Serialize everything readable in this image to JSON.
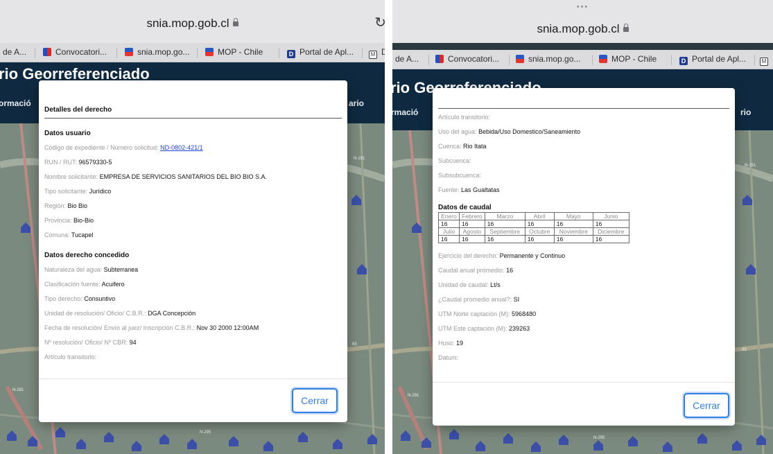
{
  "browser": {
    "url": "snia.mop.gob.cl",
    "more_dots": "•••",
    "bookmarks_left": [
      "de A...",
      "Convocatori...",
      "snia.mop.go...",
      "MOP - Chile",
      "Portal de Apl...",
      "D"
    ],
    "bookmarks_right": [
      "de A...",
      "Convocatori...",
      "snia.mop.go...",
      "MOP - Chile",
      "Portal de Apl..."
    ]
  },
  "site": {
    "title_left": "rio Georreferenciado",
    "title_right": "rio Georreferenciado",
    "nav_left": "ormació",
    "nav_right": "ario",
    "nav_left_r": "rmació",
    "nav_right_r": "rio"
  },
  "modal_left": {
    "title": "Detalles del derecho",
    "section_usuario": "Datos usuario",
    "expediente_label": "Código de expediente / Número solicitud:",
    "expediente_value": "ND-0802-421/1",
    "rut_label": "RUN / RUT:",
    "rut_value": "96579330-5",
    "nombre_label": "Nombre solicitante:",
    "nombre_value": "EMPRESA DE SERVICIOS SANITARIOS DEL BIO BIO S.A.",
    "tipo_sol_label": "Tipo solicitante:",
    "tipo_sol_value": "Jurídico",
    "region_label": "Región:",
    "region_value": "Bio Bio",
    "provincia_label": "Provincia:",
    "provincia_value": "Bio-Bio",
    "comuna_label": "Comuna:",
    "comuna_value": "Tucapel",
    "section_derecho": "Datos derecho concedido",
    "naturaleza_label": "Naturaleza del agua:",
    "naturaleza_value": "Subterranea",
    "clasif_label": "Clasificación fuente:",
    "clasif_value": "Acuifero",
    "tipo_der_label": "Tipo derecho:",
    "tipo_der_value": "Consuntivo",
    "unidad_res_label": "Unidad de resolución/ Oficio/ C.B.R.:",
    "unidad_res_value": "DGA Concepción",
    "fecha_label": "Fecha de resolución/ Envío al juez/ Inscripción C.B.R.:",
    "fecha_value": "Nov 30 2000 12:00AM",
    "nro_label": "Nº resolución/ Oficio/ Nº CBR:",
    "nro_value": "94",
    "articulo_label": "Artículo transitorio:",
    "close_label": "Cerrar"
  },
  "modal_right": {
    "articulo_label": "Artículo transitorio:",
    "uso_label": "Uso del agua:",
    "uso_value": "Bebida/Uso Domestico/Saneamiento",
    "cuenca_label": "Cuenca:",
    "cuenca_value": "Rio Itata",
    "subcuenca_label": "Subcuenca:",
    "subsubcuenca_label": "Subsubcuenca:",
    "fuente_label": "Fuente:",
    "fuente_value": "Las Gualtatas",
    "section_caudal": "Datos de caudal",
    "months_1": [
      "Enero",
      "Febrero",
      "Marzo",
      "Abril",
      "Mayo",
      "Junio"
    ],
    "values_1": [
      "16",
      "16",
      "16",
      "16",
      "16",
      "16"
    ],
    "months_2": [
      "Julio",
      "Agosto",
      "Septiembre",
      "Octubre",
      "Noviembre",
      "Diciembre"
    ],
    "values_2": [
      "16",
      "16",
      "16",
      "16",
      "16",
      "16"
    ],
    "ejercicio_label": "Ejercicio del derecho:",
    "ejercicio_value": "Permanente y Continuo",
    "caudal_anual_label": "Caudal anual promedio:",
    "caudal_anual_value": "16",
    "unidad_caudal_label": "Unidad de caudal:",
    "unidad_caudal_value": "Lt/s",
    "promedio_anual_label": "¿Caudal promedio anual?:",
    "promedio_anual_value": "SI",
    "utm_norte_label": "UTM Norte captación (M):",
    "utm_norte_value": "5968480",
    "utm_este_label": "UTM Este captación (M):",
    "utm_este_value": "239263",
    "huso_label": "Huso:",
    "huso_value": "19",
    "datum_label": "Datum:",
    "close_label": "Cerrar"
  },
  "map_labels": {
    "road_n151": "N-151",
    "road_n295": "N-295",
    "road_n291": "N-291",
    "road_65": "65"
  },
  "colors": {
    "header_bg": "#0f2a40",
    "link": "#1a3fd6",
    "button_accent": "#2f7fe6",
    "map_pin": "#3b4fa8"
  }
}
